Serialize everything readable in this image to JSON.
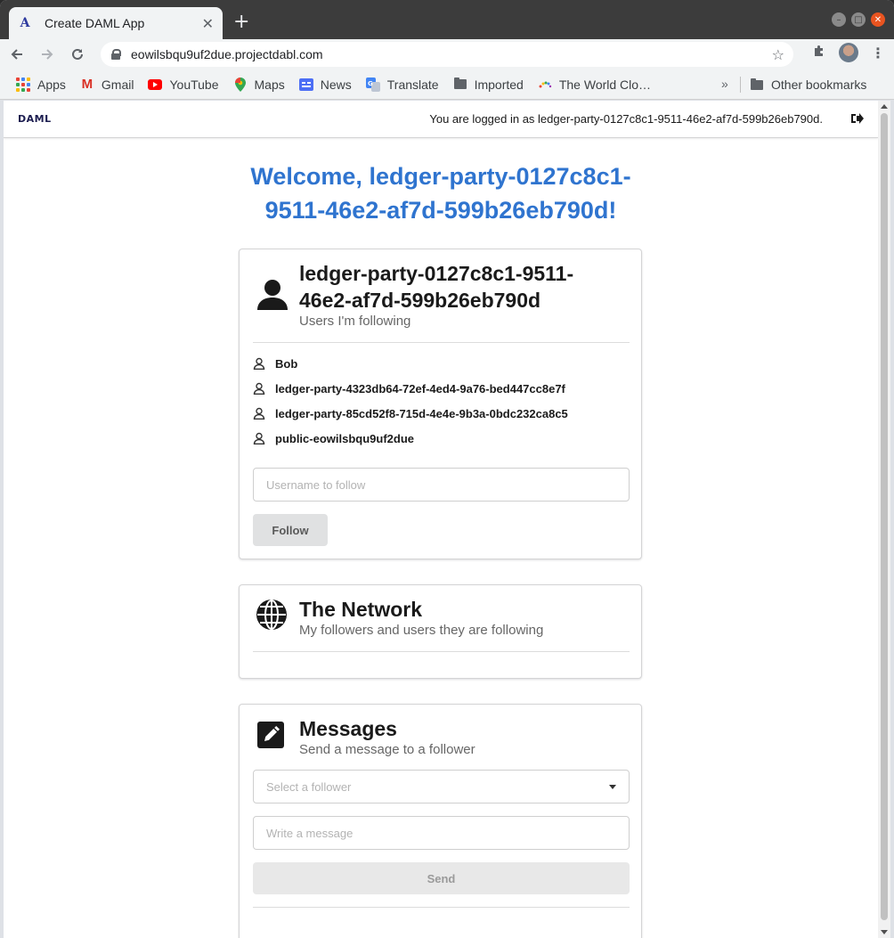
{
  "browser": {
    "tab_title": "Create DAML App",
    "tab_favicon_glyph": "A",
    "new_tab_glyph": "+",
    "close_tab_glyph": "✕",
    "url": "eowilsbqu9uf2due.projectdabl.com",
    "bookmarks": [
      {
        "label": "Apps",
        "icon": "apps-grid-icon"
      },
      {
        "label": "Gmail",
        "icon": "gmail-icon"
      },
      {
        "label": "YouTube",
        "icon": "youtube-icon"
      },
      {
        "label": "Maps",
        "icon": "maps-icon"
      },
      {
        "label": "News",
        "icon": "news-icon"
      },
      {
        "label": "Translate",
        "icon": "translate-icon"
      },
      {
        "label": "Imported",
        "icon": "folder-icon"
      },
      {
        "label": "The World Clo…",
        "icon": "world-clock-icon"
      }
    ],
    "bookmarks_overflow": "»",
    "other_bookmarks": "Other bookmarks"
  },
  "header": {
    "logo": "DAML",
    "logged_in_text": "You are logged in as ledger-party-0127c8c1-9511-46e2-af7d-599b26eb790d."
  },
  "welcome": {
    "line1": "Welcome, ledger-party-0127c8c1-",
    "line2": "9511-46e2-af7d-599b26eb790d!"
  },
  "user_card": {
    "title_line1": "ledger-party-0127c8c1-9511-",
    "title_line2": "46e2-af7d-599b26eb790d",
    "subtitle": "Users I'm following",
    "following": [
      "Bob",
      "ledger-party-4323db64-72ef-4ed4-9a76-bed447cc8e7f",
      "ledger-party-85cd52f8-715d-4e4e-9b3a-0bdc232ca8c5",
      "public-eowilsbqu9uf2due"
    ],
    "input_placeholder": "Username to follow",
    "follow_button": "Follow"
  },
  "network_card": {
    "title": "The Network",
    "subtitle": "My followers and users they are following"
  },
  "messages_card": {
    "title": "Messages",
    "subtitle": "Send a message to a follower",
    "select_placeholder": "Select a follower",
    "message_placeholder": "Write a message",
    "send_button": "Send"
  },
  "colors": {
    "accent": "#2f74cf",
    "logo": "#1b1c4f",
    "button_bg": "#e0e1e2"
  }
}
